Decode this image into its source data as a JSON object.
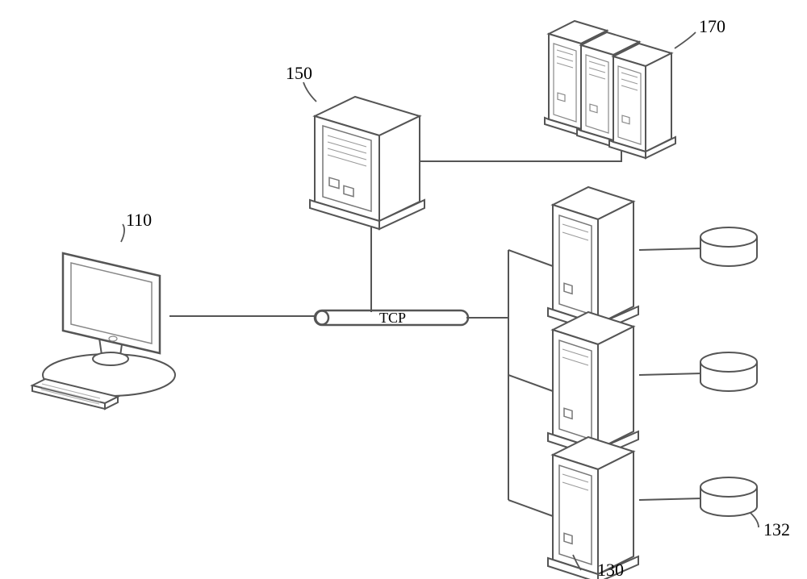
{
  "labels": {
    "client": "110",
    "server_a": "150",
    "server_cluster": "170",
    "server_bottom": "130",
    "disk_bottom": "132",
    "bus": "TCP"
  }
}
